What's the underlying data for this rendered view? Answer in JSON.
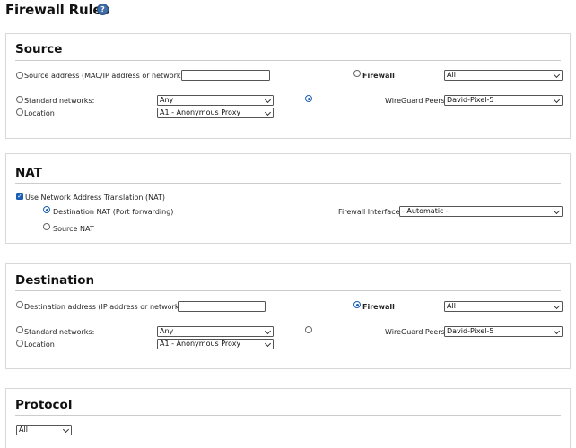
{
  "page": {
    "title": "Firewall Rules",
    "help_icon": "question-circle-icon",
    "help_glyph": "?"
  },
  "source": {
    "title": "Source",
    "address_label": "Source address (MAC/IP address or network):",
    "address_value": "",
    "firewall_label": "Firewall",
    "firewall_select": "All",
    "std_networks_label": "Standard networks:",
    "std_networks_select": "Any",
    "location_label": "Location",
    "location_select": "A1 - Anonymous Proxy",
    "wireguard_label": "WireGuard Peers",
    "wireguard_select": "David-Pixel-5"
  },
  "nat": {
    "title": "NAT",
    "use_nat_label": "Use Network Address Translation (NAT)",
    "use_nat_checked": true,
    "dnat_label": "Destination NAT (Port forwarding)",
    "snat_label": "Source NAT",
    "fw_iface_label": "Firewall Interface:",
    "fw_iface_select": "- Automatic -"
  },
  "destination": {
    "title": "Destination",
    "address_label": "Destination address (IP address or network):",
    "address_value": "",
    "firewall_label": "Firewall",
    "firewall_select": "All",
    "std_networks_label": "Standard networks:",
    "std_networks_select": "Any",
    "location_label": "Location",
    "location_select": "A1 - Anonymous Proxy",
    "wireguard_label": "WireGuard Peers",
    "wireguard_select": "David-Pixel-5"
  },
  "protocol": {
    "title": "Protocol",
    "select": "All"
  },
  "colors": {
    "accent": "#1a5fb4",
    "border": "#d8d8d8",
    "help": "#3f6ea8"
  }
}
